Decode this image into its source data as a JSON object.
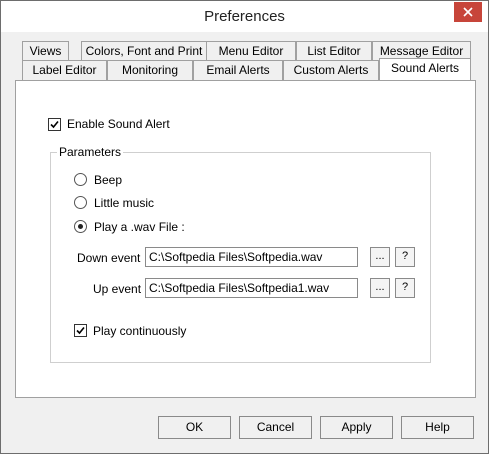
{
  "window": {
    "title": "Preferences"
  },
  "tabs": {
    "row1": [
      "Views",
      "Colors, Font and Print",
      "Menu Editor",
      "List Editor",
      "Message Editor"
    ],
    "row2": [
      "Label Editor",
      "Monitoring",
      "Email Alerts",
      "Custom Alerts",
      "Sound Alerts"
    ],
    "active": "Sound Alerts"
  },
  "sound": {
    "enable_label": "Enable Sound Alert",
    "enable_checked": true,
    "group_title": "Parameters",
    "options": [
      "Beep",
      "Little music",
      "Play a .wav File :"
    ],
    "selected_option": "Play a .wav File :",
    "down_event_label": "Down event",
    "down_event_value": "C:\\Softpedia Files\\Softpedia.wav",
    "up_event_label": "Up event",
    "up_event_value": "C:\\Softpedia Files\\Softpedia1.wav",
    "browse_label": "...",
    "help_label": "?",
    "play_cont_label": "Play continuously",
    "play_cont_checked": true
  },
  "buttons": {
    "ok": "OK",
    "cancel": "Cancel",
    "apply": "Apply",
    "help": "Help"
  }
}
